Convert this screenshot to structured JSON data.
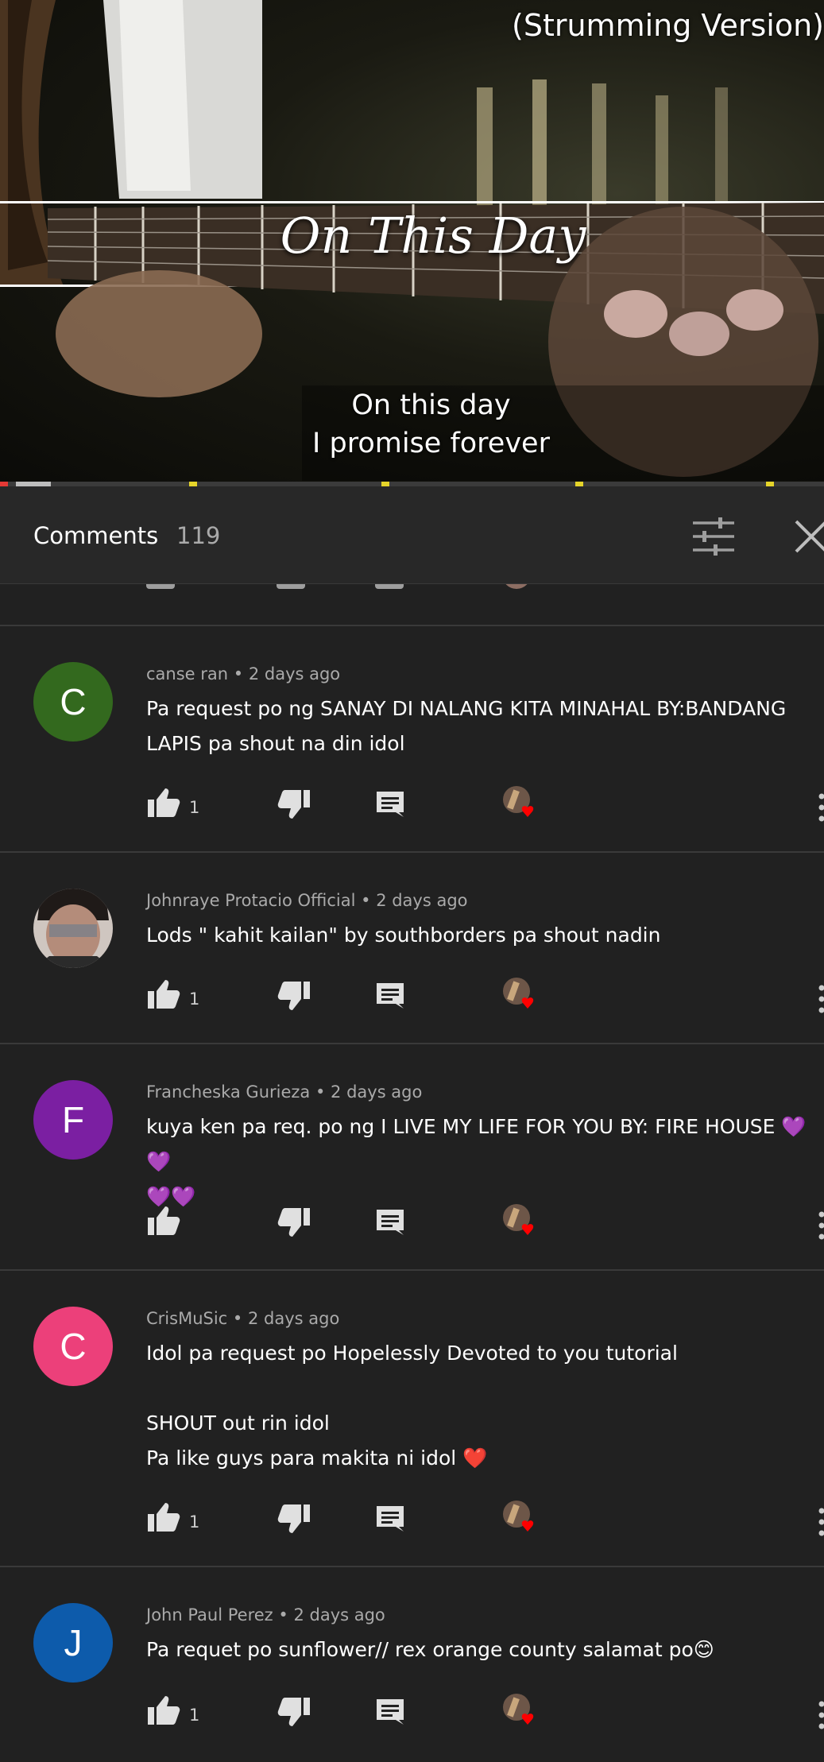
{
  "video": {
    "title_top": "(Strumming Version)",
    "title_script": "On This Day",
    "caption_line1": "On this day",
    "caption_line2": "I promise forever",
    "progress_fraction": 0.06
  },
  "comments_header": {
    "title": "Comments",
    "count": "119",
    "sort_icon": "tune-icon",
    "close_icon": "close-icon"
  },
  "colors": {
    "background": "#212121",
    "header": "#282828",
    "progress": "#e53935",
    "heart": "#ff0000"
  },
  "comments": [
    {
      "initial": "C",
      "avatar_color": "#33691e",
      "author": "canse ran",
      "time": "2 days ago",
      "text": "Pa request po ng SANAY DI NALANG KITA MINAHAL BY:BANDANG\nLAPIS pa shout na din idol",
      "likes": "1"
    },
    {
      "initial": "",
      "avatar_color": "#6b5a52",
      "author": "Johnraye Protacio Official",
      "time": "2 days ago",
      "text": "Lods \" kahit kailan\" by southborders pa shout nadin",
      "likes": "1"
    },
    {
      "initial": "F",
      "avatar_color": "#7b1fa2",
      "author": "Francheska Gurieza",
      "time": "2 days ago",
      "text": "kuya ken pa req. po ng I LIVE MY LIFE FOR YOU BY: FIRE HOUSE 💜💜\n💜💜",
      "likes": ""
    },
    {
      "initial": "C",
      "avatar_color": "#ec407a",
      "author": "CrisMuSic",
      "time": "2 days ago",
      "text": "Idol pa request po Hopelessly Devoted to you tutorial\n\nSHOUT out rin idol\nPa like guys para makita ni idol ❤️",
      "likes": "1"
    },
    {
      "initial": "J",
      "avatar_color": "#0d5bab",
      "author": "John Paul Perez",
      "time": "2 days ago",
      "text": "Pa requet po sunflower// rex orange county salamat po😊",
      "likes": "1"
    }
  ]
}
